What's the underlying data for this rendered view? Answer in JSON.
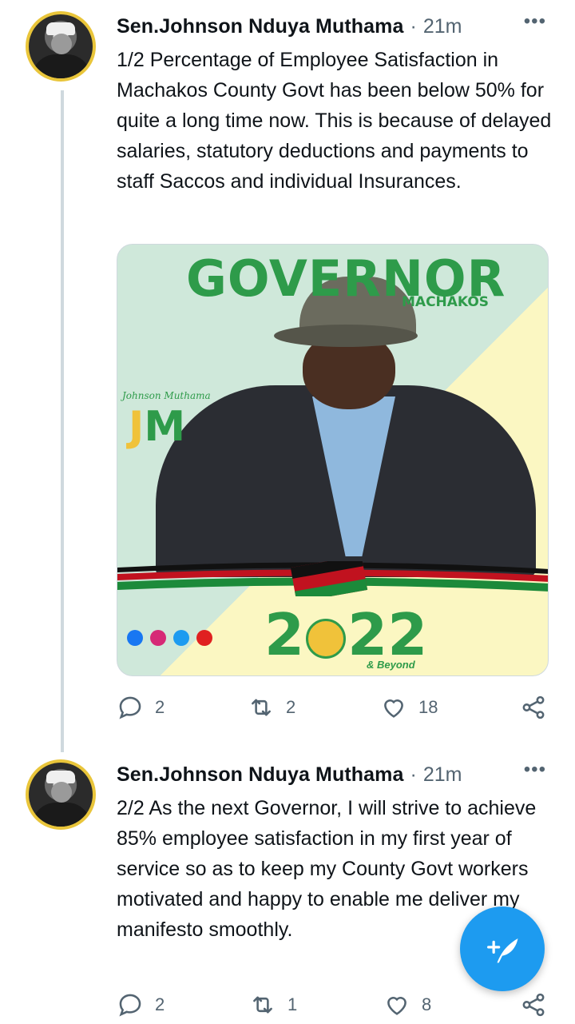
{
  "colors": {
    "accent": "#1d9bf0",
    "muted": "#536471",
    "thread": "#cfd9de",
    "brand_green": "#2e9b4a",
    "brand_yellow": "#f0c23a"
  },
  "tweets": [
    {
      "author": "Sen.Johnson Nduya Muthama",
      "separator": "·",
      "time": "21m",
      "more_icon": "more-dots-icon",
      "text": "1/2 Percentage of Employee Satisfaction in Machakos County Govt has been below 50% for quite a long time now. This is because of delayed salaries, statutory deductions and payments to staff Saccos and individual Insurances.",
      "media": {
        "headline": "GOVERNOR",
        "subheadline": "MACHAKOS",
        "signature": "Johnson Muthama",
        "logo_left": "J",
        "logo_right": "M",
        "year_left": "2",
        "year_right": "22",
        "tagline": "& Beyond",
        "social_icons": [
          "facebook-icon",
          "instagram-icon",
          "twitter-icon",
          "youtube-icon"
        ]
      },
      "actions": {
        "replies": "2",
        "retweets": "2",
        "likes": "18"
      }
    },
    {
      "author": "Sen.Johnson Nduya Muthama",
      "separator": "·",
      "time": "21m",
      "more_icon": "more-dots-icon",
      "text": "2/2 As the next Governor, I will strive to achieve 85% employee satisfaction in my first year of service so as to keep my County Govt workers motivated and happy to enable me deliver my manifesto smoothly.",
      "actions": {
        "replies": "2",
        "retweets": "1",
        "likes": "8"
      }
    }
  ],
  "fab": {
    "icon": "compose-tweet-icon"
  }
}
